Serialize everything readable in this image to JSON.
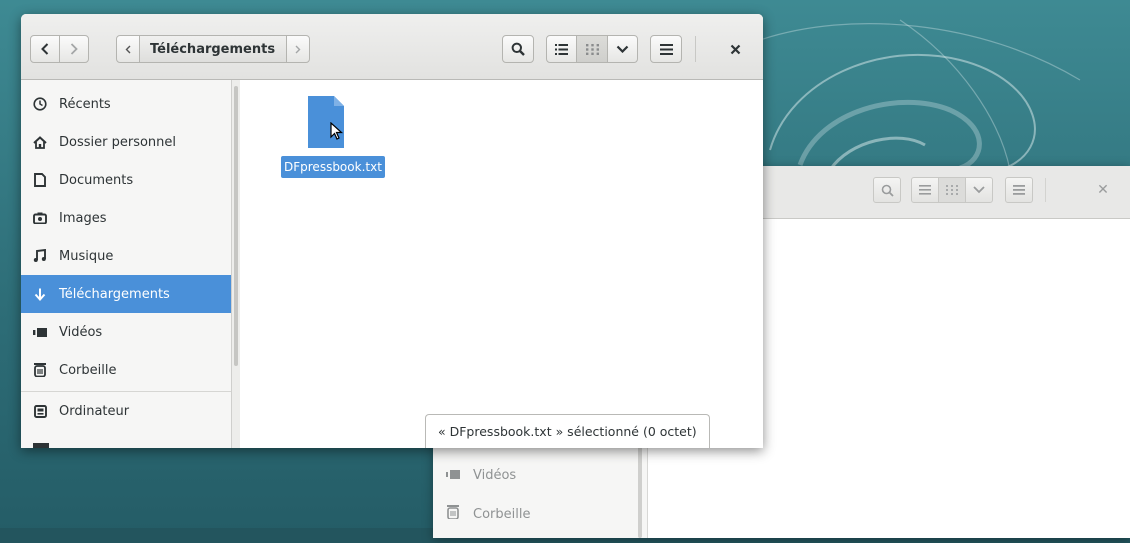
{
  "front_window": {
    "path_bar": {
      "current_folder": "Téléchargements"
    },
    "sidebar": {
      "items": [
        {
          "label": "Récents",
          "icon": "clock-icon"
        },
        {
          "label": "Dossier personnel",
          "icon": "home-icon"
        },
        {
          "label": "Documents",
          "icon": "document-icon"
        },
        {
          "label": "Images",
          "icon": "camera-icon"
        },
        {
          "label": "Musique",
          "icon": "music-icon"
        },
        {
          "label": "Téléchargements",
          "icon": "download-icon",
          "selected": true
        },
        {
          "label": "Vidéos",
          "icon": "video-icon"
        },
        {
          "label": "Corbeille",
          "icon": "trash-icon"
        },
        {
          "label": "Ordinateur",
          "icon": "computer-icon"
        }
      ]
    },
    "files": [
      {
        "name": "DFpressbook.txt",
        "icon": "text-file-icon",
        "selected": true
      }
    ],
    "status": "« DFpressbook.txt » sélectionné  (0 octet)"
  },
  "back_window": {
    "sidebar": {
      "items": [
        {
          "label": "Vidéos",
          "icon": "video-icon"
        },
        {
          "label": "Corbeille",
          "icon": "trash-icon"
        }
      ]
    }
  },
  "colors": {
    "selection": "#4a90d9",
    "desktop": "#2f6f79"
  }
}
